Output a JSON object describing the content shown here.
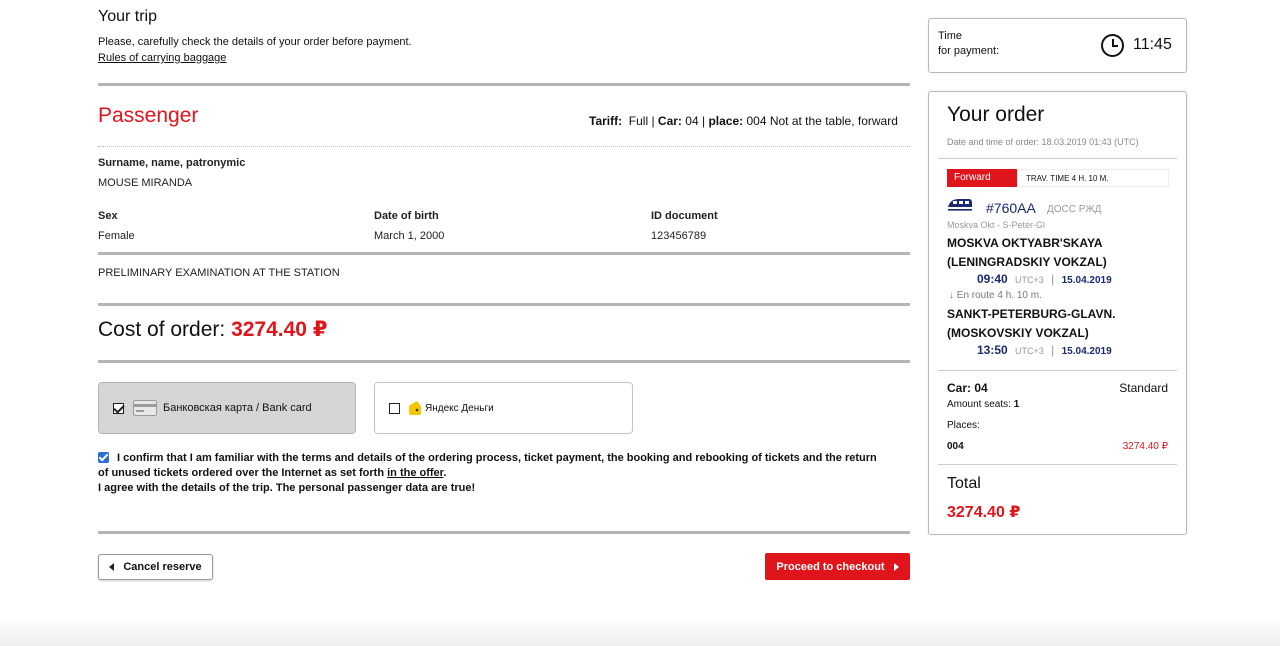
{
  "header": {
    "title": "Your trip",
    "subtitle": "Please, carefully check the details of your order before payment.",
    "baggage_link": "Rules of carrying baggage"
  },
  "passenger_section": {
    "heading": "Passenger",
    "tariff_label": "Tariff:",
    "tariff_value": "Full",
    "car_label": "Car:",
    "car_value": "04",
    "place_label": "place:",
    "place_value": "004 Not at the table, forward",
    "name_label": "Surname, name, patronymic",
    "name_value": "MOUSE MIRANDA",
    "sex_label": "Sex",
    "sex_value": "Female",
    "dob_label": "Date of birth",
    "dob_value": "March 1, 2000",
    "id_label": "ID document",
    "id_value": "123456789",
    "note": "PRELIMINARY EXAMINATION AT THE STATION"
  },
  "cost": {
    "label": "Cost of order:",
    "amount": "3274.40 ₽"
  },
  "payment": {
    "card_label": "Банковская карта / Bank card",
    "card_selected": true,
    "yandex_label": "Яндекс Деньги",
    "yandex_selected": false
  },
  "confirmation": {
    "text_part1": "I confirm that I am familiar with the terms and details of the ordering process, ticket payment, the booking and rebooking of tickets and the return of unused tickets ordered over the Internet as set forth ",
    "offer_link": "in the offer",
    "text_part2": ".",
    "line2": "I agree with the details of the trip. The personal passenger data are true!",
    "checked": true
  },
  "buttons": {
    "cancel": "Cancel reserve",
    "proceed": "Proceed to checkout"
  },
  "timer": {
    "label_line1": "Time",
    "label_line2": "for payment:",
    "value": "11:45"
  },
  "order": {
    "title": "Your order",
    "datetime": "Date and time of order: 18.03.2019 01:43 (UTC)",
    "direction_badge": "Forward",
    "travel_time": "TRAV. TIME 4 H. 10 M.",
    "train_number": "#760AA",
    "train_type": "ДОСС РЖД",
    "route": "Moskva Okt - S-Peter-Gl",
    "departure_station_line1": "MOSKVA OKTYABR'SKAYA",
    "departure_station_line2": "(LENINGRADSKIY VOKZAL)",
    "departure_time": "09:40",
    "departure_tz": "UTC+3",
    "departure_date": "15.04.2019",
    "en_route": "En route  4 h. 10 m.",
    "arrival_station_line1": "SANKT-PETERBURG-GLAVN.",
    "arrival_station_line2": "(MOSKOVSKIY VOKZAL)",
    "arrival_time": "13:50",
    "arrival_tz": "UTC+3",
    "arrival_date": "15.04.2019",
    "car": "Car: 04",
    "car_class": "Standard",
    "amount_seats_label": "Amount seats:",
    "amount_seats_value": "1",
    "places_label": "Places:",
    "place_number": "004",
    "place_price": "3274.40 ₽",
    "total_label": "Total",
    "total_value": "3274.40 ₽"
  },
  "colors": {
    "accent_red": "#e0151b",
    "divider_gray": "#b5b5b5",
    "checkbox_blue": "#2a6fd6"
  }
}
